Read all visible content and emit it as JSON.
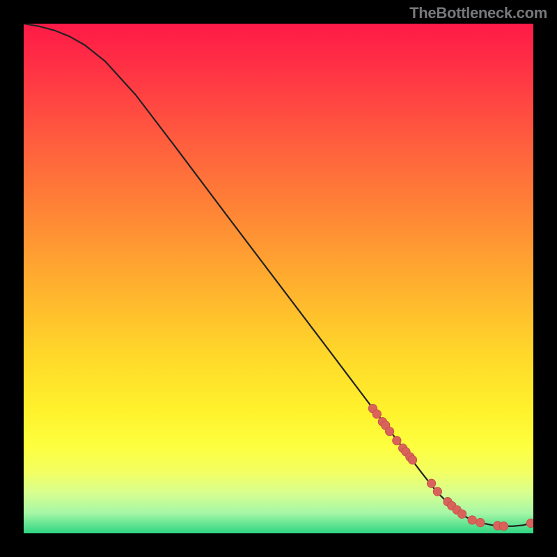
{
  "watermark": "TheBottleneck.com",
  "colors": {
    "curve_stroke": "#222222",
    "dot_fill": "#d9635a",
    "dot_stroke": "#c24c47"
  },
  "chart_data": {
    "type": "line",
    "title": "",
    "xlabel": "",
    "ylabel": "",
    "xlim": [
      0,
      100
    ],
    "ylim": [
      0,
      100
    ],
    "grid": false,
    "series": [
      {
        "name": "curve",
        "x": [
          0,
          3,
          6,
          9,
          12,
          16,
          22,
          30,
          40,
          50,
          60,
          68,
          74,
          78,
          81,
          84,
          86,
          88,
          90,
          92,
          94,
          96,
          98,
          100
        ],
        "y": [
          100,
          99.5,
          98.7,
          97.5,
          95.8,
          92.6,
          86.0,
          75.5,
          62.2,
          49.0,
          35.8,
          25.2,
          17.3,
          12.0,
          8.2,
          5.2,
          3.6,
          2.6,
          2.0,
          1.6,
          1.4,
          1.4,
          1.6,
          2.1
        ]
      }
    ],
    "dots": {
      "name": "dots",
      "x": [
        68.5,
        69.3,
        70.4,
        71.0,
        71.8,
        73.2,
        74.4,
        75.0,
        75.8,
        76.3,
        80.0,
        81.2,
        83.2,
        84.0,
        85.0,
        86.0,
        88.0,
        89.6,
        93.0,
        94.2,
        99.5
      ],
      "y": [
        24.5,
        23.4,
        21.9,
        21.2,
        20.0,
        18.2,
        16.7,
        16.0,
        15.0,
        14.4,
        9.8,
        8.2,
        6.2,
        5.4,
        4.6,
        3.8,
        2.6,
        2.1,
        1.5,
        1.4,
        2.0
      ]
    }
  }
}
